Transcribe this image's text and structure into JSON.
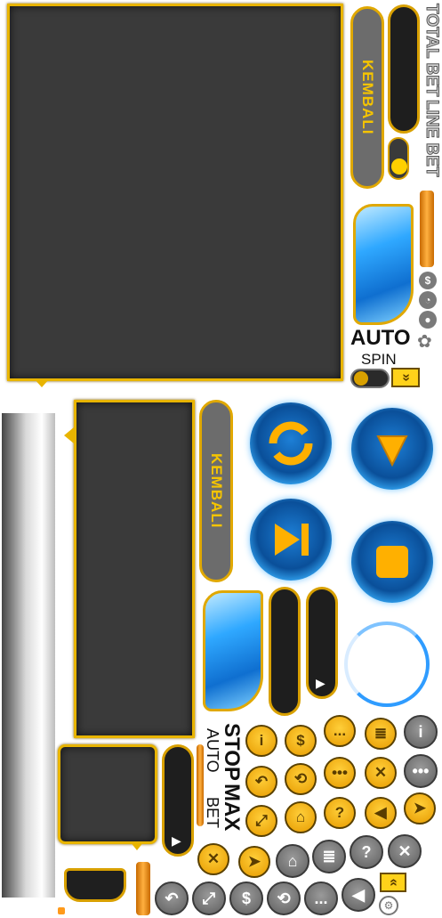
{
  "labels": {
    "kembali_top": "KEMBALI",
    "kembali_mid": "KEMBALI",
    "total_bet": "TOTAL BET",
    "line_bet": "LINE BET",
    "auto": "AUTO",
    "spin": "SPIN",
    "stop": "STOP",
    "max": "MAX",
    "auto_small": "AUTO",
    "bet_small": "BET"
  },
  "icons": {
    "info": "i",
    "coins": "$",
    "chat": "...",
    "dots": "•••",
    "undo": "↶",
    "history": "⟲",
    "mute": "✕",
    "question": "?",
    "sound": "◀",
    "home": "⌂",
    "expand": "⤢",
    "arrow": "➤",
    "chevron": "»",
    "play": "▶"
  },
  "colors": {
    "gold": "#e8b400",
    "panel": "#3a3a3a",
    "blue": "#1d7fd6",
    "grey": "#6c6c6c",
    "orange": "#ff9a1a"
  }
}
